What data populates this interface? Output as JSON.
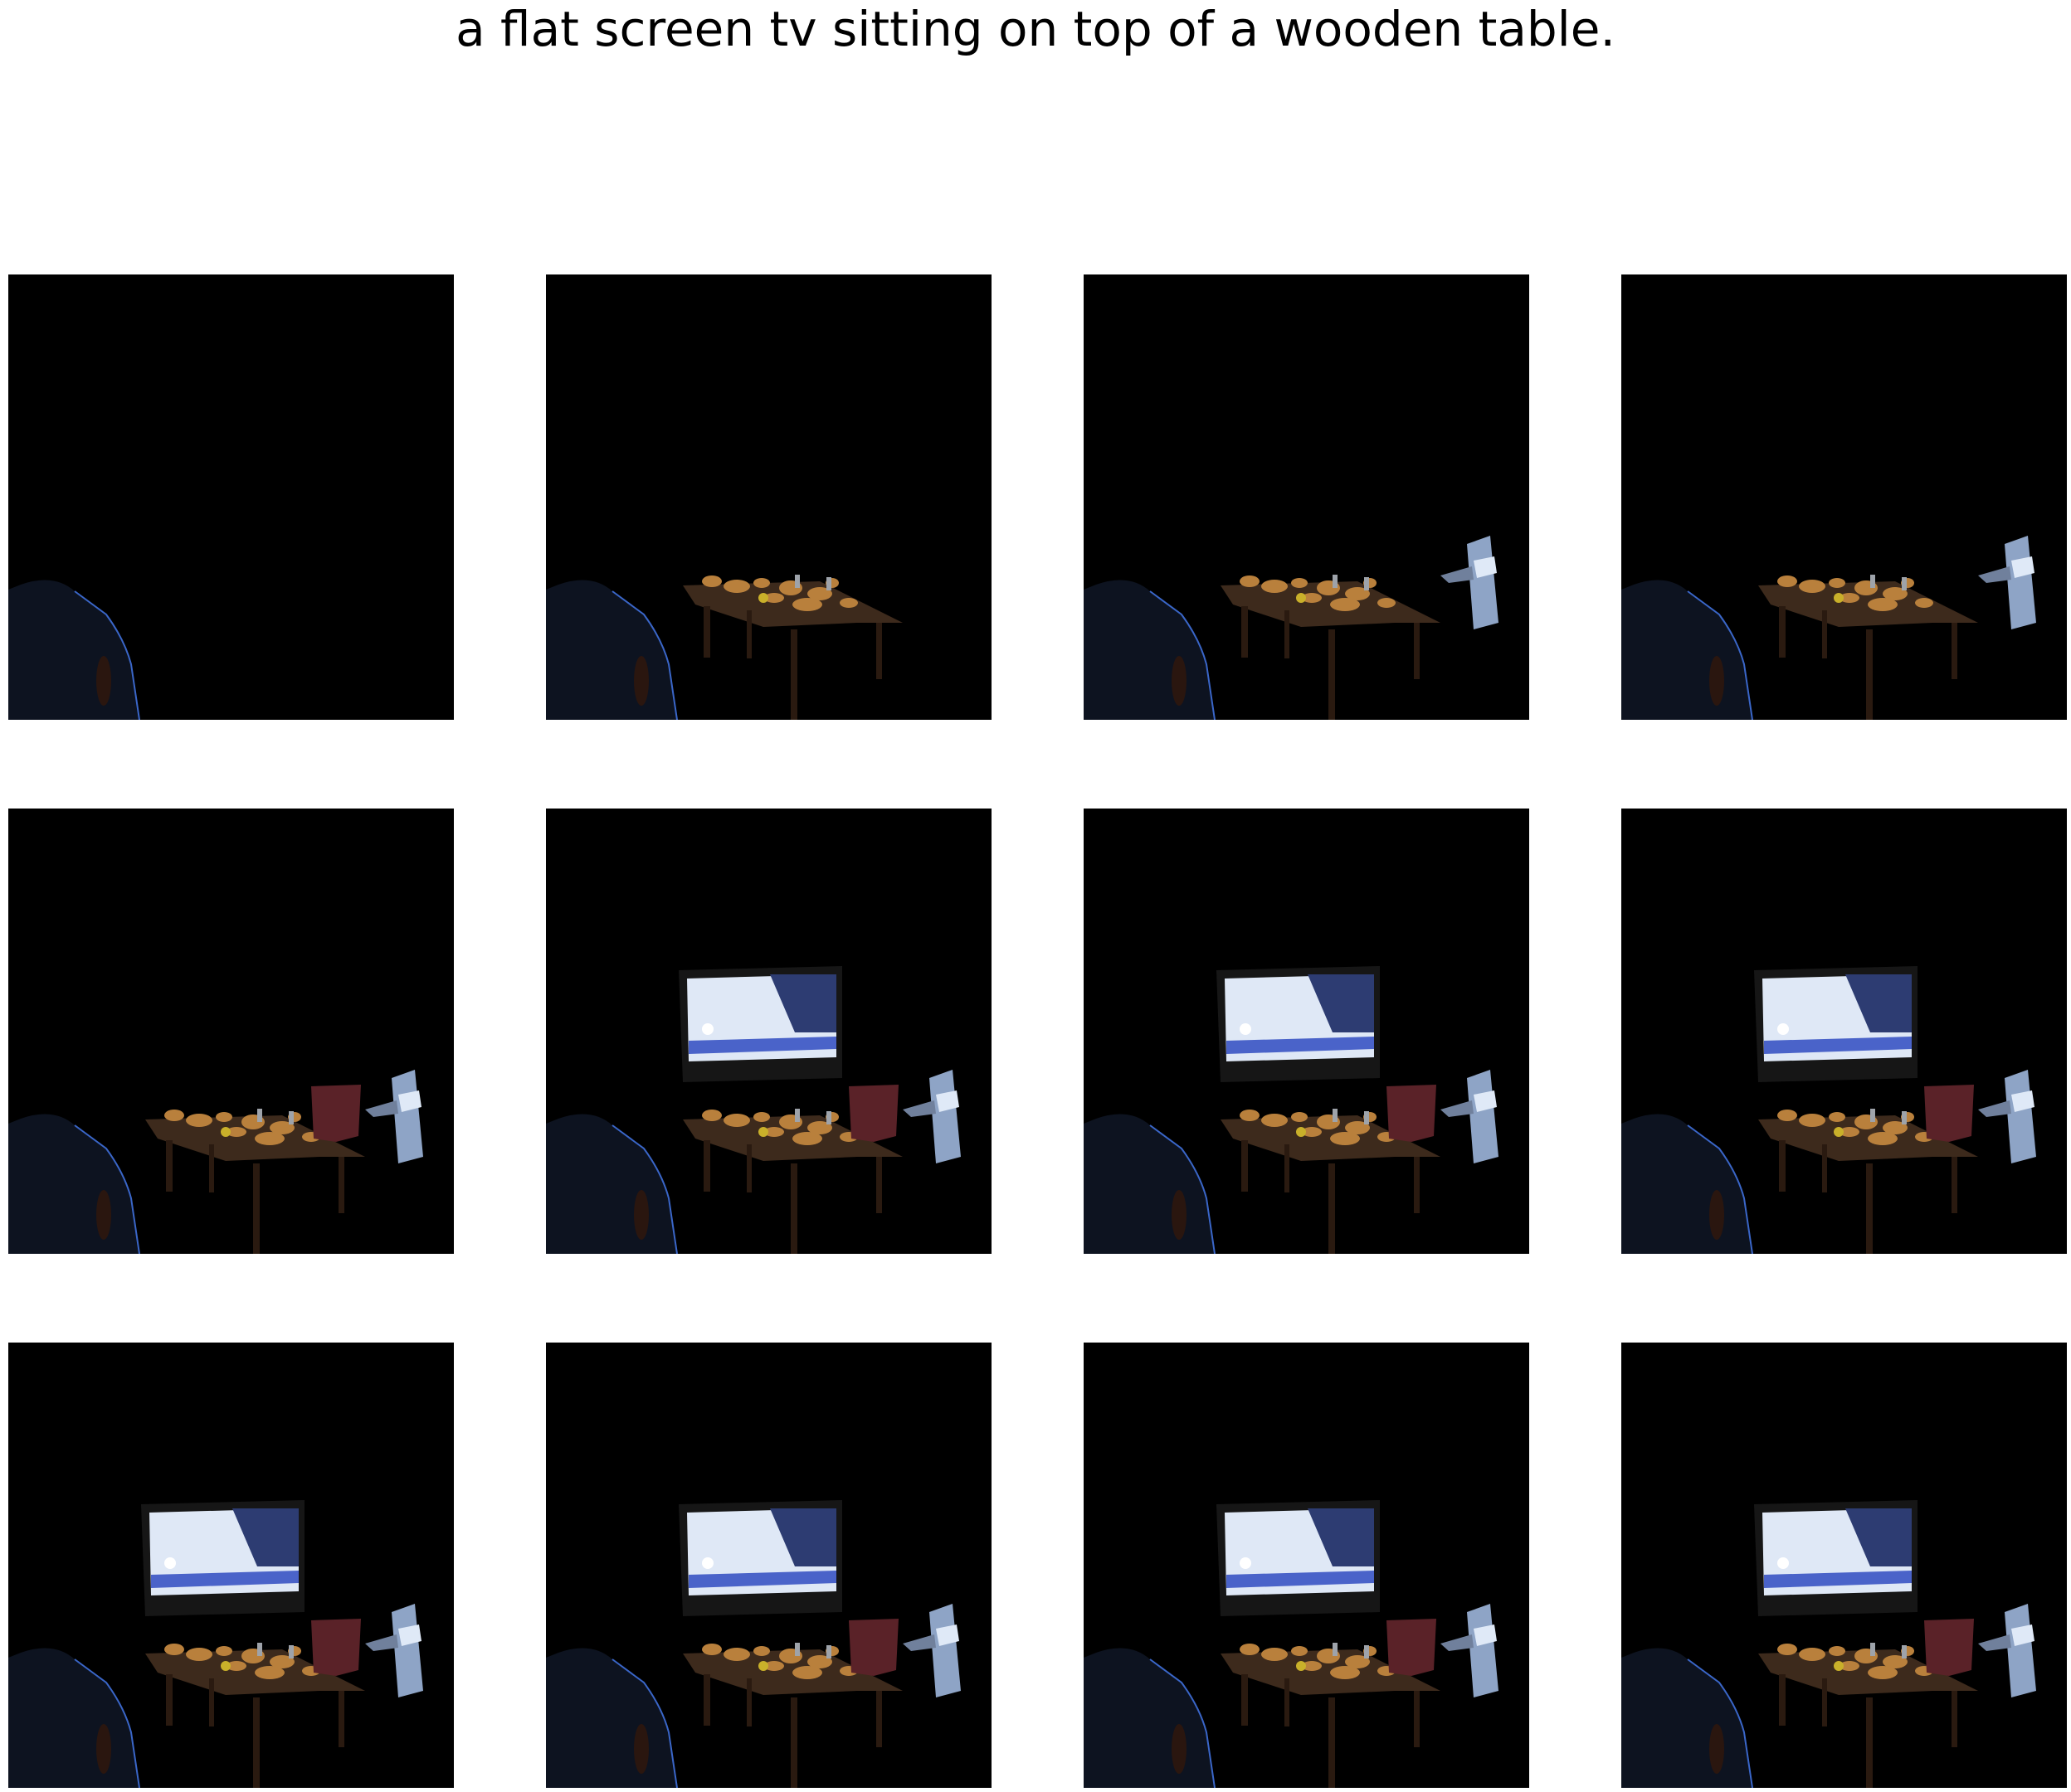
{
  "caption": "a flat screen tv sitting on top of a wooden table.",
  "frames": [
    {
      "chair": true,
      "table": false,
      "tv": false,
      "red_chair": false,
      "glass_object": false
    },
    {
      "chair": true,
      "table": true,
      "tv": false,
      "red_chair": false,
      "glass_object": false
    },
    {
      "chair": true,
      "table": true,
      "tv": false,
      "red_chair": false,
      "glass_object": true
    },
    {
      "chair": true,
      "table": true,
      "tv": false,
      "red_chair": false,
      "glass_object": true
    },
    {
      "chair": true,
      "table": true,
      "tv": false,
      "red_chair": true,
      "glass_object": true
    },
    {
      "chair": true,
      "table": true,
      "tv": true,
      "red_chair": true,
      "glass_object": true
    },
    {
      "chair": true,
      "table": true,
      "tv": true,
      "red_chair": true,
      "glass_object": true
    },
    {
      "chair": true,
      "table": true,
      "tv": true,
      "red_chair": true,
      "glass_object": true
    },
    {
      "chair": true,
      "table": true,
      "tv": true,
      "red_chair": true,
      "glass_object": true
    },
    {
      "chair": true,
      "table": true,
      "tv": true,
      "red_chair": true,
      "glass_object": true
    },
    {
      "chair": true,
      "table": true,
      "tv": true,
      "red_chair": true,
      "glass_object": true
    },
    {
      "chair": true,
      "table": true,
      "tv": true,
      "red_chair": true,
      "glass_object": true
    }
  ],
  "colors": {
    "background": "#000000",
    "chair": "#0d1320",
    "chair_edge": "#3a66c8",
    "table_top": "#3d2a1c",
    "table_leg": "#2a1a10",
    "food": "#b9803c",
    "tv_frame": "#161616",
    "tv_screen": "#dfe8f6",
    "tv_accent": "#2d3c72",
    "red_chair": "#5a2228",
    "glass_object": "#8ea4c6"
  }
}
